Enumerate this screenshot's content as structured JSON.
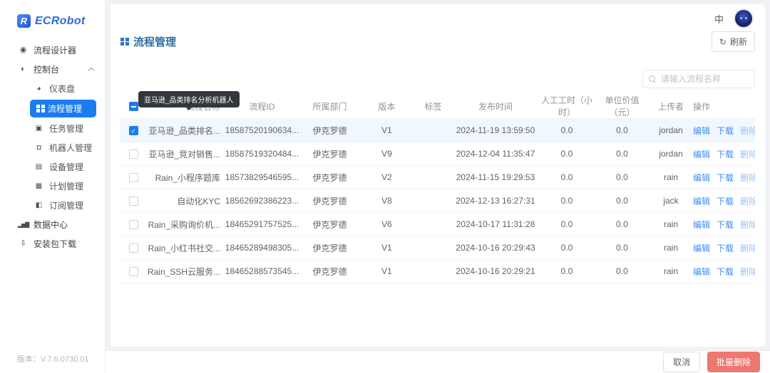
{
  "brand": {
    "logo_text": "ECRobot"
  },
  "icons": {
    "process_designer": "◉",
    "console": "◐",
    "dashboard": "◕",
    "task_mgmt": "▣",
    "robot_mgmt": "◘",
    "device_mgmt": "▤",
    "plan_mgmt": "▦",
    "subscription_mgmt": "◧",
    "data_center": "▂▅▇",
    "package_download": "⇩",
    "refresh": "↻"
  },
  "sidebar": {
    "items": {
      "process_designer": "流程设计器",
      "console": "控制台",
      "dashboard": "仪表盘",
      "process_mgmt": "流程管理",
      "task_mgmt": "任务管理",
      "robot_mgmt": "机器人管理",
      "device_mgmt": "设备管理",
      "plan_mgmt": "计划管理",
      "subscription_mgmt": "订阅管理",
      "data_center": "数据中心",
      "package_download": "安装包下载"
    },
    "version": "版本：V.7.6.0730.01"
  },
  "topbar": {
    "language": "中"
  },
  "page": {
    "title": "流程管理",
    "refresh_label": "刷新"
  },
  "search": {
    "placeholder": "请输入流程名称"
  },
  "tooltip": {
    "text": "亚马逊_品类排名分析机器人"
  },
  "table": {
    "headers": [
      "流程名称",
      "流程ID",
      "所属部门",
      "版本",
      "标签",
      "发布时间",
      "人工工时（小时）",
      "单位价值（元）",
      "上传者",
      "操作"
    ],
    "action_labels": [
      "编辑",
      "下载",
      "删除"
    ],
    "rows": [
      {
        "name": "亚马逊_品类排名...",
        "id": "18587520190634...",
        "dept": "伊克罗德",
        "version": "V1",
        "tag": "",
        "time": "2024-11-19 13:59:50",
        "hours": "0.0",
        "value": "0.0",
        "uploader": "jordan",
        "checked": true
      },
      {
        "name": "亚马逊_竞对销售...",
        "id": "18587519320484...",
        "dept": "伊克罗德",
        "version": "V9",
        "tag": "",
        "time": "2024-12-04 11:35:47",
        "hours": "0.0",
        "value": "0.0",
        "uploader": "jordan",
        "checked": false
      },
      {
        "name": "Rain_小程序题库",
        "id": "18573829546595...",
        "dept": "伊克罗德",
        "version": "V2",
        "tag": "",
        "time": "2024-11-15 19:29:53",
        "hours": "0.0",
        "value": "0.0",
        "uploader": "rain",
        "checked": false
      },
      {
        "name": "自动化KYC",
        "id": "18562692386223...",
        "dept": "伊克罗德",
        "version": "V8",
        "tag": "",
        "time": "2024-12-13 16:27:31",
        "hours": "0.0",
        "value": "0.0",
        "uploader": "jack",
        "checked": false
      },
      {
        "name": "Rain_采购询价机...",
        "id": "18465291757525...",
        "dept": "伊克罗德",
        "version": "V6",
        "tag": "",
        "time": "2024-10-17 11:31:28",
        "hours": "0.0",
        "value": "0.0",
        "uploader": "rain",
        "checked": false
      },
      {
        "name": "Rain_小红书社交...",
        "id": "18465289498305...",
        "dept": "伊克罗德",
        "version": "V1",
        "tag": "",
        "time": "2024-10-16 20:29:43",
        "hours": "0.0",
        "value": "0.0",
        "uploader": "rain",
        "checked": false
      },
      {
        "name": "Rain_SSH云服务...",
        "id": "18465288573545...",
        "dept": "伊克罗德",
        "version": "V1",
        "tag": "",
        "time": "2024-10-16 20:29:21",
        "hours": "0.0",
        "value": "0.0",
        "uploader": "rain",
        "checked": false
      }
    ]
  },
  "footer": {
    "cancel_label": "取消",
    "batch_delete_label": "批量删除"
  },
  "colors": {
    "primary": "#1b7cf2",
    "link": "#3e8ef7",
    "link_light": "#9dc3f0",
    "danger": "#ee7770",
    "brand": "#2f6bdc"
  }
}
